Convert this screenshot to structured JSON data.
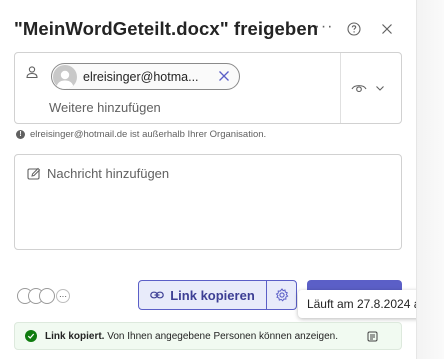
{
  "header": {
    "title": "\"MeinWordGeteilt.docx\" freigeben",
    "more_label": "···"
  },
  "recipients": {
    "chip_label": "elreisinger@hotma...",
    "add_more_placeholder": "Weitere hinzufügen",
    "permission_icon": "eye-icon"
  },
  "external_notice": {
    "icon_label": "!",
    "text": "elreisinger@hotmail.de ist außerhalb Ihrer Organisation."
  },
  "message": {
    "placeholder": "Nachricht hinzufügen"
  },
  "footer": {
    "more_people": "···",
    "copy_link_label": "Link kopieren",
    "settings_icon": "gear-icon",
    "accent_color": "#5b5fc7"
  },
  "tooltip": {
    "text": "Läuft am 27.8.2024 ab"
  },
  "toast": {
    "title": "Link kopiert.",
    "text": "Von Ihnen angegebene Personen können anzeigen.",
    "status_color": "#107c10"
  }
}
